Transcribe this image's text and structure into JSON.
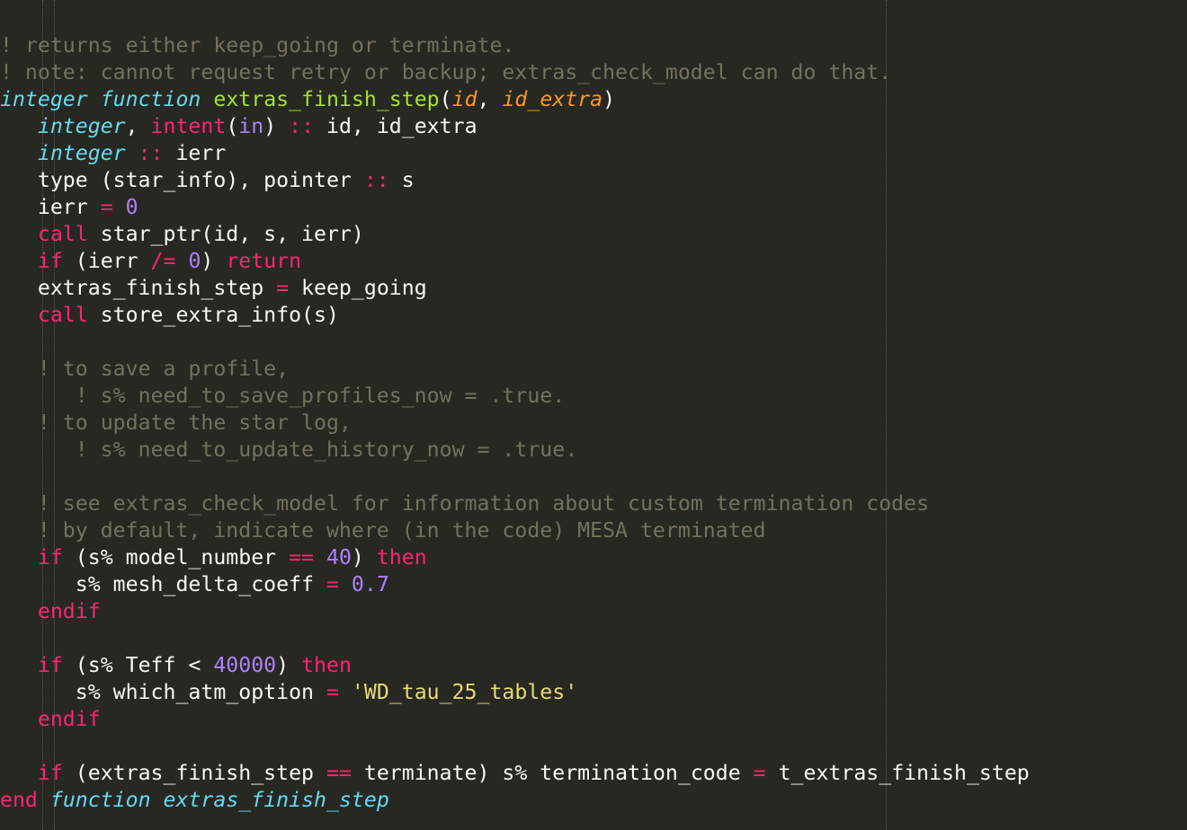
{
  "editor": {
    "language": "fortran",
    "theme": {
      "background": "#272822",
      "foreground": "#f8f8f2",
      "comment": "#75715e",
      "type": "#66d9ef",
      "function": "#a6e22e",
      "argument": "#fd971f",
      "keyword": "#f92672",
      "number": "#ae81ff",
      "string": "#e6db74"
    }
  },
  "lines": [
    [
      [
        "c",
        "! returns either keep_going or terminate."
      ]
    ],
    [
      [
        "c",
        "! note: cannot request retry or backup; extras_check_model can do that."
      ]
    ],
    [
      [
        "t",
        "integer"
      ],
      [
        "p",
        " "
      ],
      [
        "t",
        "function"
      ],
      [
        "p",
        " "
      ],
      [
        "f",
        "extras_finish_step"
      ],
      [
        "p",
        "("
      ],
      [
        "a",
        "id"
      ],
      [
        "p",
        ", "
      ],
      [
        "a",
        "id_extra"
      ],
      [
        "p",
        ")"
      ]
    ],
    [
      [
        "p",
        "   "
      ],
      [
        "t",
        "integer"
      ],
      [
        "p",
        ", "
      ],
      [
        "k",
        "intent"
      ],
      [
        "p",
        "("
      ],
      [
        "n",
        "in"
      ],
      [
        "p",
        ") "
      ],
      [
        "k",
        "::"
      ],
      [
        "p",
        " id, id_extra"
      ]
    ],
    [
      [
        "p",
        "   "
      ],
      [
        "t",
        "integer"
      ],
      [
        "p",
        " "
      ],
      [
        "k",
        "::"
      ],
      [
        "p",
        " ierr"
      ]
    ],
    [
      [
        "p",
        "   type (star_info), pointer "
      ],
      [
        "k",
        "::"
      ],
      [
        "p",
        " s"
      ]
    ],
    [
      [
        "p",
        "   ierr "
      ],
      [
        "k",
        "="
      ],
      [
        "p",
        " "
      ],
      [
        "n",
        "0"
      ]
    ],
    [
      [
        "p",
        "   "
      ],
      [
        "k",
        "call"
      ],
      [
        "p",
        " star_ptr(id, s, ierr)"
      ]
    ],
    [
      [
        "p",
        "   "
      ],
      [
        "k",
        "if"
      ],
      [
        "p",
        " (ierr "
      ],
      [
        "k",
        "/="
      ],
      [
        "p",
        " "
      ],
      [
        "n",
        "0"
      ],
      [
        "p",
        ") "
      ],
      [
        "k",
        "return"
      ]
    ],
    [
      [
        "p",
        "   extras_finish_step "
      ],
      [
        "k",
        "="
      ],
      [
        "p",
        " keep_going"
      ]
    ],
    [
      [
        "p",
        "   "
      ],
      [
        "k",
        "call"
      ],
      [
        "p",
        " store_extra_info(s)"
      ]
    ],
    [
      [
        "p",
        ""
      ]
    ],
    [
      [
        "p",
        "   "
      ],
      [
        "c",
        "! to save a profile,"
      ]
    ],
    [
      [
        "p",
        "      "
      ],
      [
        "c",
        "! s% need_to_save_profiles_now = .true."
      ]
    ],
    [
      [
        "p",
        "   "
      ],
      [
        "c",
        "! to update the star log,"
      ]
    ],
    [
      [
        "p",
        "      "
      ],
      [
        "c",
        "! s% need_to_update_history_now = .true."
      ]
    ],
    [
      [
        "p",
        ""
      ]
    ],
    [
      [
        "p",
        "   "
      ],
      [
        "c",
        "! see extras_check_model for information about custom termination codes"
      ]
    ],
    [
      [
        "p",
        "   "
      ],
      [
        "c",
        "! by default, indicate where (in the code) MESA terminated"
      ]
    ],
    [
      [
        "p",
        "   "
      ],
      [
        "k",
        "if"
      ],
      [
        "p",
        " (s% model_number "
      ],
      [
        "k",
        "=="
      ],
      [
        "p",
        " "
      ],
      [
        "n",
        "40"
      ],
      [
        "p",
        ") "
      ],
      [
        "k",
        "then"
      ]
    ],
    [
      [
        "p",
        "      s% mesh_delta_coeff "
      ],
      [
        "k",
        "="
      ],
      [
        "p",
        " "
      ],
      [
        "n",
        "0.7"
      ]
    ],
    [
      [
        "p",
        "   "
      ],
      [
        "k",
        "endif"
      ]
    ],
    [
      [
        "p",
        ""
      ]
    ],
    [
      [
        "p",
        "   "
      ],
      [
        "k",
        "if"
      ],
      [
        "p",
        " (s% Teff < "
      ],
      [
        "n",
        "40000"
      ],
      [
        "p",
        ") "
      ],
      [
        "k",
        "then"
      ]
    ],
    [
      [
        "p",
        "      s% which_atm_option "
      ],
      [
        "k",
        "="
      ],
      [
        "p",
        " "
      ],
      [
        "s",
        "'WD_tau_25_tables'"
      ]
    ],
    [
      [
        "p",
        "   "
      ],
      [
        "k",
        "endif"
      ]
    ],
    [
      [
        "p",
        ""
      ]
    ],
    [
      [
        "p",
        "   "
      ],
      [
        "k",
        "if"
      ],
      [
        "p",
        " (extras_finish_step "
      ],
      [
        "k",
        "=="
      ],
      [
        "p",
        " terminate) s% termination_code "
      ],
      [
        "k",
        "="
      ],
      [
        "p",
        " t_extras_finish_step"
      ]
    ],
    [
      [
        "k",
        "end"
      ],
      [
        "p",
        " "
      ],
      [
        "t",
        "function"
      ],
      [
        "p",
        " "
      ],
      [
        "t",
        "extras_finish_step"
      ]
    ]
  ]
}
